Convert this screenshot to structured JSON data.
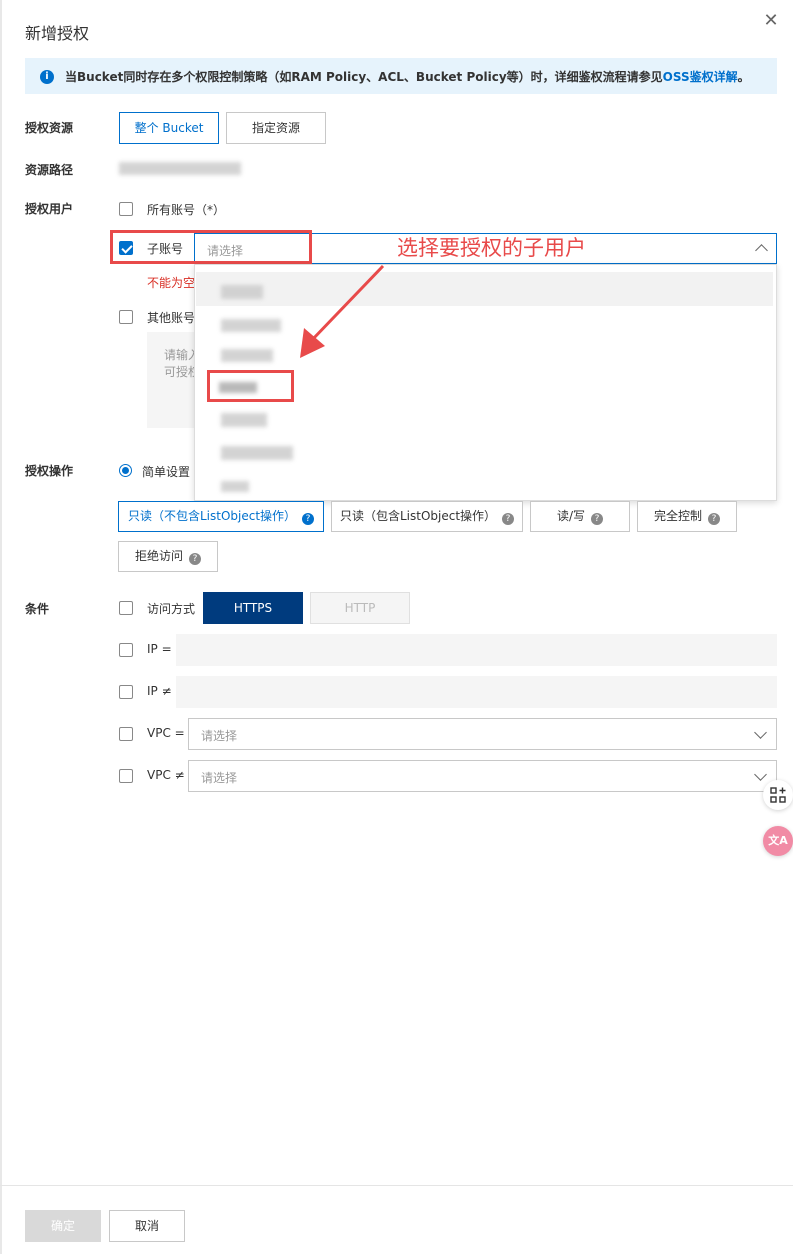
{
  "dialog": {
    "title": "新增授权"
  },
  "notice": {
    "text": "当Bucket同时存在多个权限控制策略（如RAM Policy、ACL、Bucket Policy等）时，详细鉴权流程请参见",
    "link": "OSS鉴权详解",
    "suffix": "。"
  },
  "resource": {
    "label": "授权资源",
    "options": [
      "整个 Bucket",
      "指定资源"
    ],
    "path_label": "资源路径"
  },
  "user": {
    "label": "授权用户",
    "all_accounts": "所有账号（*）",
    "sub_account": "子账号",
    "sub_placeholder": "请选择",
    "error": "不能为空",
    "other_account": "其他账号",
    "other_hint_line1": "请输入",
    "other_hint_line2": "可授权"
  },
  "annotation": {
    "text": "选择要授权的子用户"
  },
  "action": {
    "label": "授权操作",
    "simple": "简单设置",
    "perms": [
      "只读（不包含ListObject操作）",
      "只读（包含ListObject操作）",
      "读/写",
      "完全控制",
      "拒绝访问"
    ]
  },
  "condition": {
    "label": "条件",
    "access_method": "访问方式",
    "https": "HTTPS",
    "http": "HTTP",
    "ip_eq": "IP =",
    "ip_ne": "IP ≠",
    "vpc_eq": "VPC =",
    "vpc_ne": "VPC ≠",
    "vpc_placeholder": "请选择"
  },
  "float_buttons": {
    "translate": "文A"
  },
  "footer": {
    "ok": "确定",
    "cancel": "取消"
  },
  "colors": {
    "accent": "#0070cc",
    "https_bg": "#003b7e",
    "highlight": "#e84a4a"
  }
}
